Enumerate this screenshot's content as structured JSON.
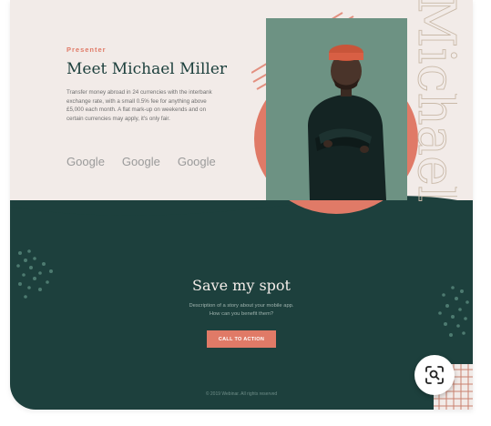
{
  "hero": {
    "eyebrow": "Presenter",
    "title": "Meet Michael Miller",
    "description": "Transfer money abroad in 24 currencies with the interbank exchange rate, with a small 0.5% fee for anything above £5,000 each month. A flat mark-up on weekends and on certain currencies may apply, it's only fair.",
    "vertical_name": "Michael",
    "logos": [
      "Google",
      "Google",
      "Google"
    ]
  },
  "cta_section": {
    "headline": "Save my spot",
    "subtext_line1": "Description of a story about your mobile app.",
    "subtext_line2": "How can you benefit them?",
    "button_label": "CALL TO ACTION"
  },
  "footer": {
    "copyright": "© 2019 Webinar. All rights reserved"
  },
  "overlay": {
    "lens_button_icon": "visual-search-icon"
  },
  "colors": {
    "cream": "#f2ebe8",
    "dark_green": "#1d403d",
    "coral": "#e07a67",
    "sage": "#6d9283"
  }
}
